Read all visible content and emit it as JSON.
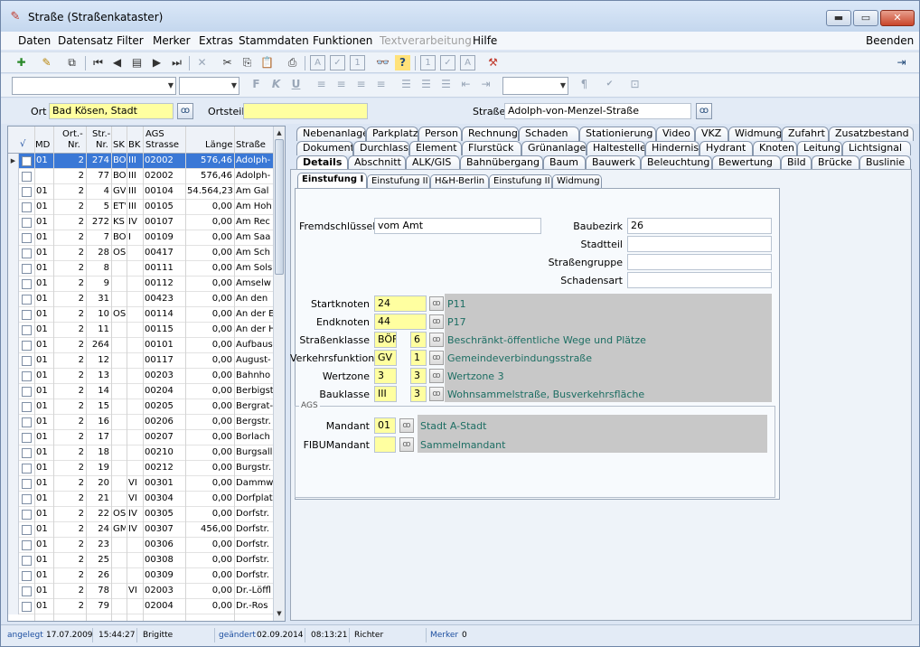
{
  "window": {
    "title": "Straße (Straßenkataster)",
    "buttons": {
      "minimize": "▬",
      "maximize": "▭",
      "close": "✕"
    }
  },
  "menu": {
    "items": [
      "Daten",
      "Datensatz",
      "Filter",
      "Merker",
      "Extras",
      "Stammdaten",
      "Funktionen",
      "Textverarbeitung",
      "Hilfe"
    ],
    "right": "Beenden"
  },
  "search": {
    "ort_label": "Ort",
    "ort_value": "Bad Kösen, Stadt",
    "ortsteil_label": "Ortsteil",
    "ortsteil_value": "",
    "strasse_label": "Straße",
    "strasse_value": "Adolph-von-Menzel-Straße"
  },
  "grid": {
    "headers": {
      "check": "√",
      "md": "MD",
      "ort_nr_1": "Ort.-",
      "ort_nr_2": "Nr.",
      "str_nr_1": "Str.-",
      "str_nr_2": "Nr.",
      "sk": "SK",
      "bk": "BK",
      "ags_1": "AGS",
      "ags_2": "Strasse",
      "laenge": "Länge",
      "strasse": "Straße"
    },
    "rows": [
      {
        "md": "01",
        "ort": "2",
        "str": "274",
        "sk": "BÖ",
        "bk": "III",
        "ags": "02002",
        "len": "576,46",
        "name": "Adolph-"
      },
      {
        "md": "",
        "ort": "2",
        "str": "77",
        "sk": "BÖ",
        "bk": "III",
        "ags": "02002",
        "len": "576,46",
        "name": "Adolph-"
      },
      {
        "md": "01",
        "ort": "2",
        "str": "4",
        "sk": "GV",
        "bk": "III",
        "ags": "00104",
        "len": "54.564,23",
        "name": "Am Gal"
      },
      {
        "md": "01",
        "ort": "2",
        "str": "5",
        "sk": "ET'",
        "bk": "III",
        "ags": "00105",
        "len": "0,00",
        "name": "Am Hoh"
      },
      {
        "md": "01",
        "ort": "2",
        "str": "272",
        "sk": "KS",
        "bk": "IV",
        "ags": "00107",
        "len": "0,00",
        "name": "Am Rec"
      },
      {
        "md": "01",
        "ort": "2",
        "str": "7",
        "sk": "BÖ",
        "bk": "I",
        "ags": "00109",
        "len": "0,00",
        "name": "Am Saa"
      },
      {
        "md": "01",
        "ort": "2",
        "str": "28",
        "sk": "OS",
        "bk": "",
        "ags": "00417",
        "len": "0,00",
        "name": "Am Sch"
      },
      {
        "md": "01",
        "ort": "2",
        "str": "8",
        "sk": "",
        "bk": "",
        "ags": "00111",
        "len": "0,00",
        "name": "Am Sols"
      },
      {
        "md": "01",
        "ort": "2",
        "str": "9",
        "sk": "",
        "bk": "",
        "ags": "00112",
        "len": "0,00",
        "name": "Amselw"
      },
      {
        "md": "01",
        "ort": "2",
        "str": "31",
        "sk": "",
        "bk": "",
        "ags": "00423",
        "len": "0,00",
        "name": "An den"
      },
      {
        "md": "01",
        "ort": "2",
        "str": "10",
        "sk": "OS",
        "bk": "",
        "ags": "00114",
        "len": "0,00",
        "name": "An der E"
      },
      {
        "md": "01",
        "ort": "2",
        "str": "11",
        "sk": "",
        "bk": "",
        "ags": "00115",
        "len": "0,00",
        "name": "An der H"
      },
      {
        "md": "01",
        "ort": "2",
        "str": "264",
        "sk": "",
        "bk": "",
        "ags": "00101",
        "len": "0,00",
        "name": "Aufbaus"
      },
      {
        "md": "01",
        "ort": "2",
        "str": "12",
        "sk": "",
        "bk": "",
        "ags": "00117",
        "len": "0,00",
        "name": "August-"
      },
      {
        "md": "01",
        "ort": "2",
        "str": "13",
        "sk": "",
        "bk": "",
        "ags": "00203",
        "len": "0,00",
        "name": "Bahnho"
      },
      {
        "md": "01",
        "ort": "2",
        "str": "14",
        "sk": "",
        "bk": "",
        "ags": "00204",
        "len": "0,00",
        "name": "Berbigst"
      },
      {
        "md": "01",
        "ort": "2",
        "str": "15",
        "sk": "",
        "bk": "",
        "ags": "00205",
        "len": "0,00",
        "name": "Bergrat-"
      },
      {
        "md": "01",
        "ort": "2",
        "str": "16",
        "sk": "",
        "bk": "",
        "ags": "00206",
        "len": "0,00",
        "name": "Bergstr."
      },
      {
        "md": "01",
        "ort": "2",
        "str": "17",
        "sk": "",
        "bk": "",
        "ags": "00207",
        "len": "0,00",
        "name": "Borlach"
      },
      {
        "md": "01",
        "ort": "2",
        "str": "18",
        "sk": "",
        "bk": "",
        "ags": "00210",
        "len": "0,00",
        "name": "Burgsall"
      },
      {
        "md": "01",
        "ort": "2",
        "str": "19",
        "sk": "",
        "bk": "",
        "ags": "00212",
        "len": "0,00",
        "name": "Burgstr."
      },
      {
        "md": "01",
        "ort": "2",
        "str": "20",
        "sk": "",
        "bk": "VI",
        "ags": "00301",
        "len": "0,00",
        "name": "Dammw"
      },
      {
        "md": "01",
        "ort": "2",
        "str": "21",
        "sk": "",
        "bk": "VI",
        "ags": "00304",
        "len": "0,00",
        "name": "Dorfplat"
      },
      {
        "md": "01",
        "ort": "2",
        "str": "22",
        "sk": "OS",
        "bk": "IV",
        "ags": "00305",
        "len": "0,00",
        "name": "Dorfstr."
      },
      {
        "md": "01",
        "ort": "2",
        "str": "24",
        "sk": "GM",
        "bk": "IV",
        "ags": "00307",
        "len": "456,00",
        "name": "Dorfstr."
      },
      {
        "md": "01",
        "ort": "2",
        "str": "23",
        "sk": "",
        "bk": "",
        "ags": "00306",
        "len": "0,00",
        "name": "Dorfstr."
      },
      {
        "md": "01",
        "ort": "2",
        "str": "25",
        "sk": "",
        "bk": "",
        "ags": "00308",
        "len": "0,00",
        "name": "Dorfstr."
      },
      {
        "md": "01",
        "ort": "2",
        "str": "26",
        "sk": "",
        "bk": "",
        "ags": "00309",
        "len": "0,00",
        "name": "Dorfstr."
      },
      {
        "md": "01",
        "ort": "2",
        "str": "78",
        "sk": "",
        "bk": "VI",
        "ags": "02003",
        "len": "0,00",
        "name": "Dr.-Löffl"
      },
      {
        "md": "01",
        "ort": "2",
        "str": "79",
        "sk": "",
        "bk": "",
        "ags": "02004",
        "len": "0,00",
        "name": "Dr.-Ros"
      }
    ]
  },
  "tabs": {
    "row1": [
      "Nebenanlage",
      "Parkplatz",
      "Person",
      "Rechnung",
      "Schaden",
      "Stationierung",
      "Video",
      "VKZ",
      "Widmung",
      "Zufahrt",
      "Zusatzbestand"
    ],
    "row2": [
      "Dokument",
      "Durchlass",
      "Element",
      "Flurstück",
      "Grünanlage",
      "Haltestelle",
      "Hindernis",
      "Hydrant",
      "Knoten",
      "Leitung",
      "Lichtsignal"
    ],
    "row3": [
      "Details",
      "Abschnitt",
      "ALK/GIS",
      "Bahnübergang",
      "Baum",
      "Bauwerk",
      "Beleuchtung",
      "Bewertung",
      "Bild",
      "Brücke",
      "Buslinie"
    ],
    "subtabs": [
      "Einstufung I",
      "Einstufung II",
      "H&H-Berlin",
      "Einstufung II",
      "Widmung"
    ]
  },
  "form": {
    "fremdschluessel_label": "Fremdschlüssel",
    "fremdschluessel_value": "vom Amt",
    "baubezirk_label": "Baubezirk",
    "baubezirk_value": "26",
    "stadtteil_label": "Stadtteil",
    "stadtteil_value": "",
    "strassengruppe_label": "Straßengruppe",
    "strassengruppe_value": "",
    "schadensart_label": "Schadensart",
    "schadensart_value": "",
    "startknoten_label": "Startknoten",
    "startknoten_value": "24",
    "startknoten_desc": "P11",
    "endknoten_label": "Endknoten",
    "endknoten_value": "44",
    "endknoten_desc": "P17",
    "strassenklasse_label": "Straßenklasse",
    "strassenklasse_code": "BÖF",
    "strassenklasse_num": "6",
    "strassenklasse_desc": "Beschränkt-öffentliche Wege und Plätze",
    "verkehrsfunktion_label": "Verkehrsfunktion",
    "verkehrsfunktion_code": "GV",
    "verkehrsfunktion_num": "1",
    "verkehrsfunktion_desc": "Gemeindeverbindungsstraße",
    "wertzone_label": "Wertzone",
    "wertzone_code": "3",
    "wertzone_num": "3",
    "wertzone_desc": "Wertzone 3",
    "bauklasse_label": "Bauklasse",
    "bauklasse_code": "III",
    "bauklasse_num": "3",
    "bauklasse_desc": "Wohnsammelstraße, Busverkehrsfläche",
    "ags_legend": "AGS",
    "mandant_label": "Mandant",
    "mandant_value": "01",
    "mandant_desc": "Stadt A-Stadt",
    "fibumandant_label": "FIBUMandant",
    "fibumandant_value": "",
    "fibumandant_desc": "Sammelmandant"
  },
  "status": {
    "angelegt_label": "angelegt",
    "angelegt_date": "17.07.2009",
    "angelegt_time": "15:44:27",
    "angelegt_user": "Brigitte",
    "geaendert_label": "geändert",
    "geaendert_date": "02.09.2014",
    "geaendert_time": "08:13:21",
    "geaendert_user": "Richter",
    "merker_label": "Merker",
    "merker_value": "0"
  },
  "colors": {
    "selected_row": "#3a78d6",
    "required_field": "#ffffa0",
    "lookup_text": "#1d6e63"
  }
}
